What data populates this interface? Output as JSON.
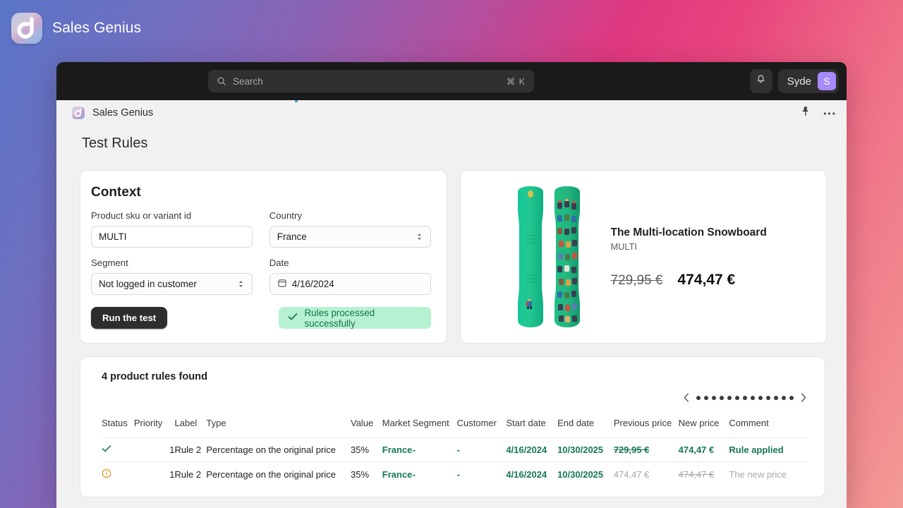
{
  "brand": {
    "name": "Sales Genius",
    "logo_icon": "sales-genius-logo-icon"
  },
  "topbar": {
    "search_placeholder": "Search",
    "search_shortcut": "⌘ K",
    "search_icon": "search-icon",
    "bell_icon": "bell-icon",
    "user_name": "Syde",
    "avatar_initial": "S",
    "avatar_color": "#a78bfa"
  },
  "app_header": {
    "title": "Sales Genius",
    "pin_icon": "pin-icon",
    "more_icon": "more-horizontal-icon"
  },
  "page": {
    "title": "Test Rules"
  },
  "context": {
    "title": "Context",
    "fields": {
      "sku_label": "Product sku or variant id",
      "sku_value": "MULTI",
      "country_label": "Country",
      "country_value": "France",
      "segment_label": "Segment",
      "segment_value": "Not logged in customer",
      "date_label": "Date",
      "date_value": "4/16/2024",
      "date_icon": "calendar-icon",
      "select_icon": "chevron-up-down-icon"
    },
    "run_button": "Run the test",
    "toast": {
      "text": "Rules processed successfully",
      "icon": "check-icon",
      "bg": "#b6f2d2",
      "fg": "#16714a"
    }
  },
  "product": {
    "name": "The Multi-location Snowboard",
    "sku": "MULTI",
    "old_price": "729,95 €",
    "new_price": "474,47 €",
    "image_alt": "snowboard-pair-image"
  },
  "rules": {
    "found_label": "4 product rules found",
    "pager": {
      "prev_icon": "chevron-left-icon",
      "next_icon": "chevron-right-icon",
      "dots": 13
    },
    "columns": [
      "Status",
      "Priority",
      "Label",
      "Type",
      "Value",
      "Market",
      "Segment",
      "Customer",
      "Start date",
      "End date",
      "Previous price",
      "New price",
      "Comment"
    ],
    "rows": [
      {
        "status": "ok",
        "status_icon": "check-icon",
        "priority": "1",
        "label": "Rule 2",
        "type": "Percentage on the original price",
        "value": "35%",
        "market": "France",
        "segment": "-",
        "customer": "-",
        "start_date": "4/16/2024",
        "end_date": "10/30/2025",
        "previous_price": "729,95 €",
        "new_price": "474,47 €",
        "comment": "Rule applied"
      },
      {
        "status": "warning",
        "status_icon": "alert-circle-icon",
        "priority": "1",
        "label": "Rule 2",
        "type": "Percentage on the original price",
        "value": "35%",
        "market": "France",
        "segment": "-",
        "customer": "-",
        "start_date": "4/16/2024",
        "end_date": "10/30/2025",
        "previous_price": "474,47 €",
        "new_price": "474,47 €",
        "comment": "The new price"
      }
    ]
  }
}
